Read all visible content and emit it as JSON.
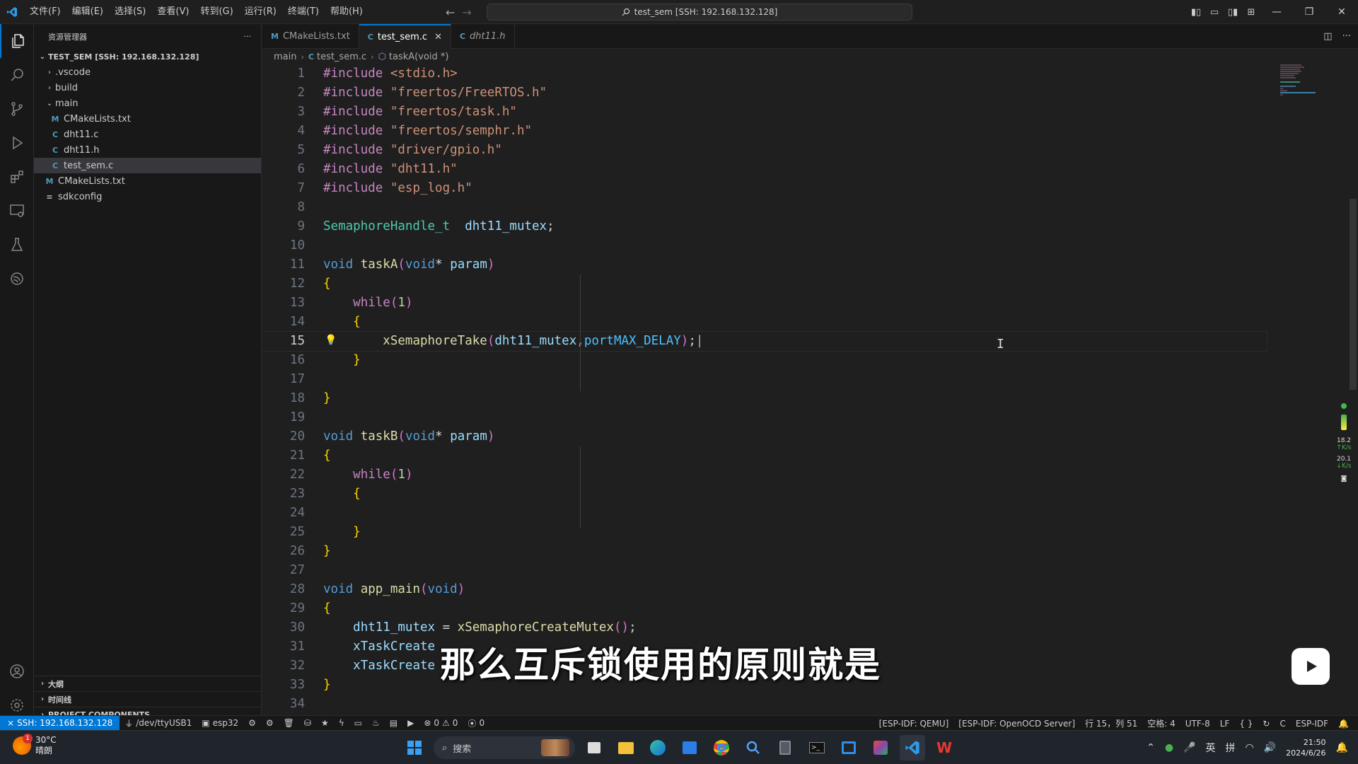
{
  "menu": [
    "文件(F)",
    "编辑(E)",
    "选择(S)",
    "查看(V)",
    "转到(G)",
    "运行(R)",
    "终端(T)",
    "帮助(H)"
  ],
  "command_center": "test_sem [SSH: 192.168.132.128]",
  "sidebar": {
    "title": "资源管理器",
    "root": "TEST_SEM [SSH: 192.168.132.128]",
    "items": [
      {
        "label": ".vscode",
        "icon": "chevron-right",
        "depth": 1
      },
      {
        "label": "build",
        "icon": "chevron-right",
        "depth": 1
      },
      {
        "label": "main",
        "icon": "chevron-down",
        "depth": 1
      },
      {
        "label": "CMakeLists.txt",
        "icon": "M",
        "depth": 2
      },
      {
        "label": "dht11.c",
        "icon": "C",
        "depth": 2
      },
      {
        "label": "dht11.h",
        "icon": "C",
        "depth": 2
      },
      {
        "label": "test_sem.c",
        "icon": "C",
        "depth": 2,
        "selected": true
      },
      {
        "label": "CMakeLists.txt",
        "icon": "M",
        "depth": 1
      },
      {
        "label": "sdkconfig",
        "icon": "≡",
        "depth": 1
      }
    ],
    "bottom_sections": [
      "大纲",
      "时间线",
      "PROJECT COMPONENTS"
    ]
  },
  "tabs": [
    {
      "label": "CMakeLists.txt",
      "icon": "M",
      "active": false,
      "italic": false
    },
    {
      "label": "test_sem.c",
      "icon": "C",
      "active": true,
      "italic": false
    },
    {
      "label": "dht11.h",
      "icon": "C",
      "active": false,
      "italic": true
    }
  ],
  "breadcrumb": [
    "main",
    "test_sem.c",
    "taskA(void *)"
  ],
  "code_lines": [
    "#include <stdio.h>",
    "#include \"freertos/FreeRTOS.h\"",
    "#include \"freertos/task.h\"",
    "#include \"freertos/semphr.h\"",
    "#include \"driver/gpio.h\"",
    "#include \"dht11.h\"",
    "#include \"esp_log.h\"",
    "",
    "SemaphoreHandle_t  dht11_mutex;",
    "",
    "void taskA(void* param)",
    "{",
    "    while(1)",
    "    {",
    "        xSemaphoreTake(dht11_mutex,portMAX_DELAY);",
    "    }",
    "",
    "}",
    "",
    "void taskB(void* param)",
    "{",
    "    while(1)",
    "    {",
    "",
    "    }",
    "}",
    "",
    "void app_main(void)",
    "{",
    "    dht11_mutex = xSemaphoreCreateMutex();",
    "    xTaskCreate",
    "    xTaskCreate",
    "}",
    ""
  ],
  "current_line": 15,
  "netmon": {
    "up": "18.2",
    "up_unit": "K/s",
    "down": "20.1",
    "down_unit": "K/s"
  },
  "subtitle": "那么互斥锁使用的原则就是",
  "statusbar": {
    "remote": "SSH: 192.168.132.128",
    "port": "/dev/ttyUSB1",
    "target": "esp32",
    "problems_errors": "0",
    "problems_warnings": "0",
    "ports": "0",
    "right": [
      "[ESP-IDF: QEMU]",
      "[ESP-IDF: OpenOCD Server]",
      "行 15，列 51",
      "空格: 4",
      "UTF-8",
      "LF",
      "{ }",
      "C",
      "ESP-IDF"
    ]
  },
  "taskbar": {
    "weather_temp": "30°C",
    "weather_desc": "晴朗",
    "weather_badge": "1",
    "search_placeholder": "搜索",
    "ime_lang": "英",
    "ime_mode": "拼",
    "time": "21:50",
    "date": "2024/6/26"
  },
  "colors": {
    "accent": "#0078d4",
    "editor_bg": "#1f1f1f",
    "sidebar_bg": "#181818"
  }
}
